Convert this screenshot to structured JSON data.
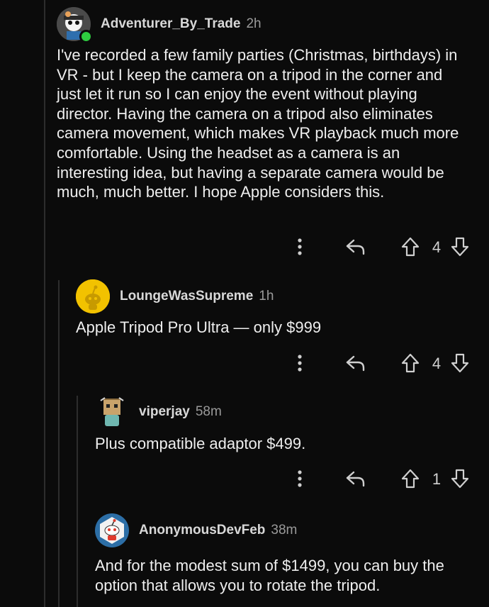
{
  "comments": [
    {
      "username": "Adventurer_By_Trade",
      "age": "2h",
      "body": "I've recorded a few family parties (Christmas, birthdays) in VR - but I keep the camera on a tripod in the corner and just let it run so I can enjoy the event without playing director. Having the camera on a tripod also eliminates camera movement, which makes VR playback much more comfortable. Using the headset as a camera is an interesting idea, but having a separate camera would be much, much better. I hope Apple considers this.",
      "score": "4",
      "online": true
    },
    {
      "username": "LoungeWasSupreme",
      "age": "1h",
      "body": "Apple Tripod Pro Ultra — only $999",
      "score": "4"
    },
    {
      "username": "viperjay",
      "age": "58m",
      "body": "Plus compatible adaptor  $499.",
      "score": "1"
    },
    {
      "username": "AnonymousDevFeb",
      "age": "38m",
      "body": "And for the modest sum of $1499, you can buy the option that allows you to rotate the tripod."
    }
  ],
  "icons": {
    "more": "more-vertical-icon",
    "reply": "reply-arrow-icon",
    "upvote": "upvote-arrow-icon",
    "downvote": "downvote-arrow-icon"
  },
  "colors": {
    "background": "#0b0b0b",
    "online": "#2ecc40",
    "username": "#d8d8d8",
    "age": "#9a9a9a"
  }
}
